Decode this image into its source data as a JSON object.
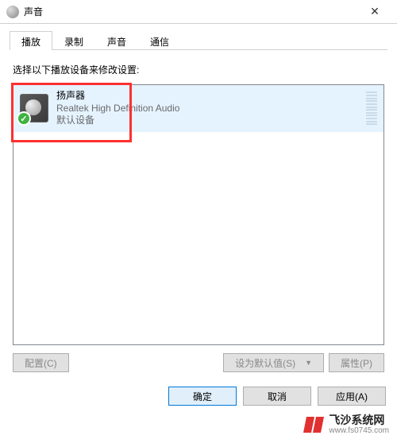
{
  "titlebar": {
    "title": "声音"
  },
  "tabs": {
    "items": [
      {
        "label": "播放"
      },
      {
        "label": "录制"
      },
      {
        "label": "声音"
      },
      {
        "label": "通信"
      }
    ],
    "active_index": 0
  },
  "instruction": "选择以下播放设备来修改设置:",
  "devices": [
    {
      "name": "扬声器",
      "description": "Realtek High Definition Audio",
      "status": "默认设备"
    }
  ],
  "buttons": {
    "configure": "配置(C)",
    "set_default": "设为默认值(S)",
    "properties": "属性(P)",
    "ok": "确定",
    "cancel": "取消",
    "apply": "应用(A)"
  },
  "watermark": {
    "name": "飞沙系统网",
    "url": "www.fs0745.com"
  }
}
